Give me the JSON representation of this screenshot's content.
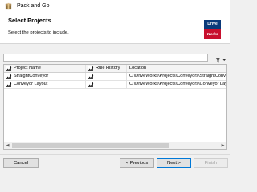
{
  "window": {
    "title": "Pack and Go"
  },
  "header": {
    "title": "Select Projects",
    "subtitle": "Select the projects to include."
  },
  "logo": {
    "line1": "Drive",
    "line2": "Works"
  },
  "search": {
    "value": "",
    "placeholder": ""
  },
  "table": {
    "columns": {
      "name": "Project Name",
      "rule_history": "Rule History",
      "location": "Location"
    },
    "rows": [
      {
        "name": "StraightConveyor",
        "location": "C:\\DriveWorks\\Projects\\Conveyors\\StraightConvey"
      },
      {
        "name": "Conveyor Layout",
        "location": "C:\\DriveWorks\\Projects\\Conveyors\\Conveyor Layo"
      }
    ]
  },
  "buttons": {
    "cancel": "Cancel",
    "previous": "< Previous",
    "next": "Next >",
    "finish": "Finish"
  },
  "colors": {
    "logo_blue": "#0a3a7a",
    "logo_red": "#c8102e",
    "primary_border": "#0078d7"
  }
}
